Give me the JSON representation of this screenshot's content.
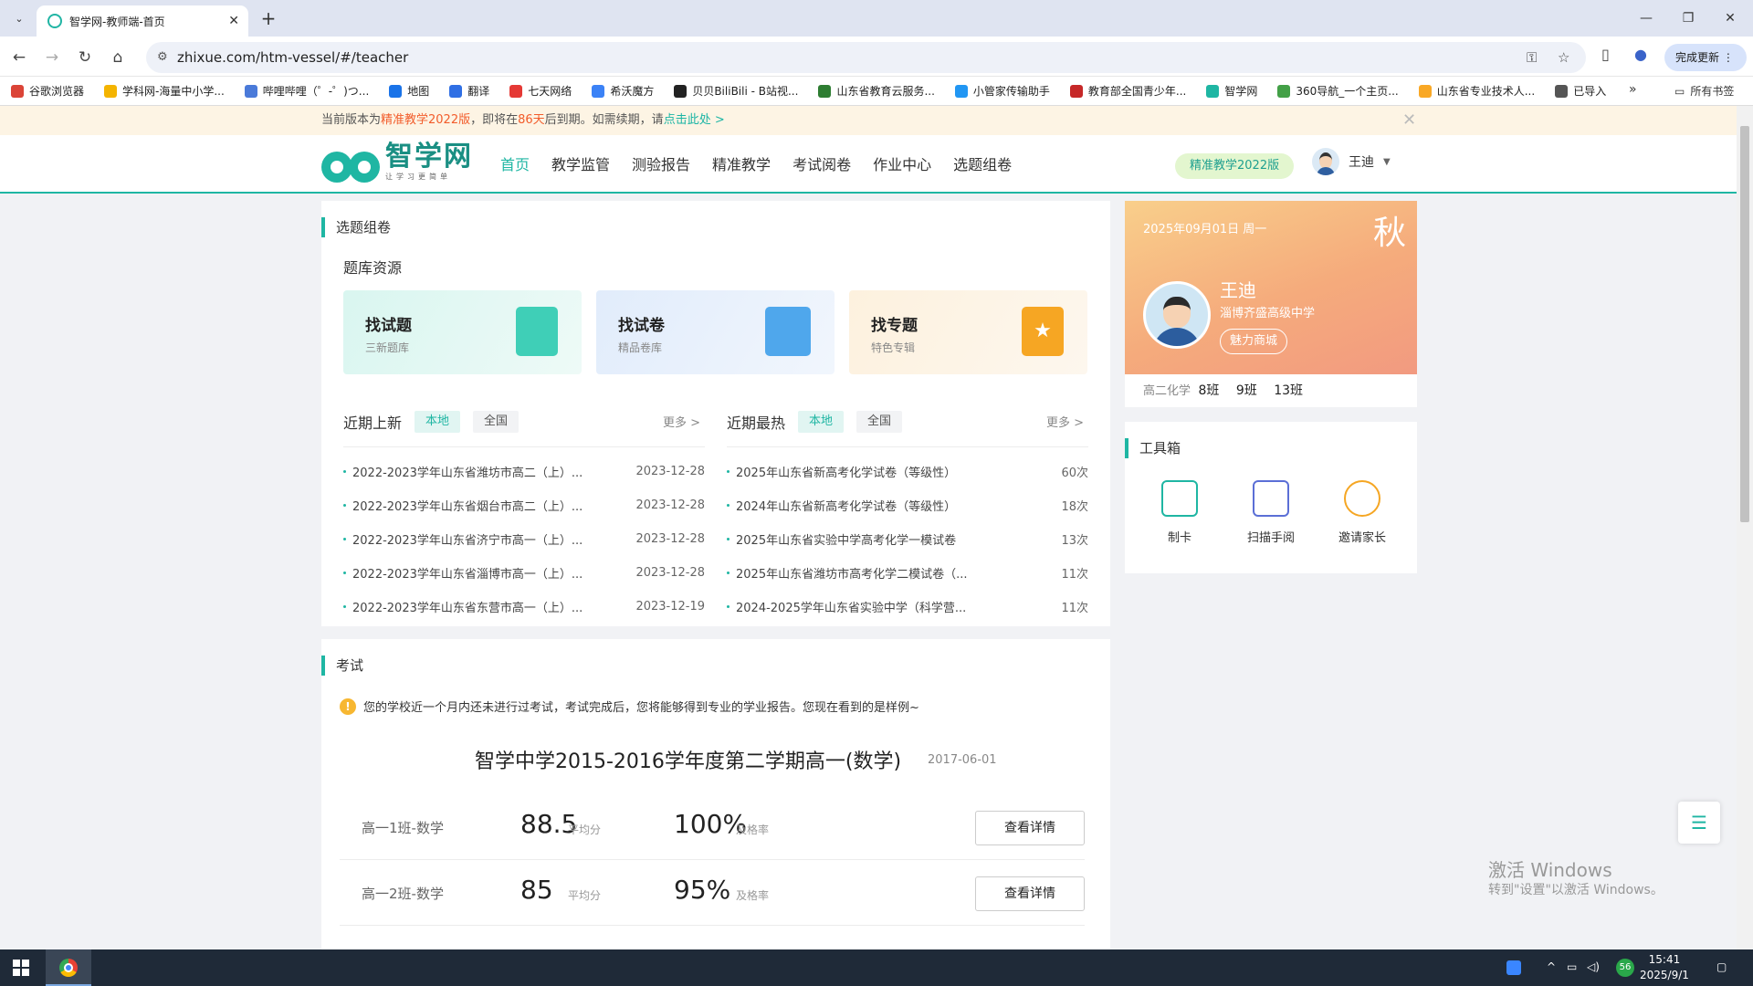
{
  "browser": {
    "tab_title": "智学网-教师端-首页",
    "url": "zhixue.com/htm-vessel/#/teacher",
    "update_label": "完成更新",
    "bookmarks": [
      {
        "label": "谷歌浏览器",
        "color": "#db4437"
      },
      {
        "label": "学科网-海量中小学...",
        "color": "#f4b400"
      },
      {
        "label": "哔哩哔哩（゜-゜)つ...",
        "color": "#4a7ad9"
      },
      {
        "label": "地图",
        "color": "#1a73e8"
      },
      {
        "label": "翻译",
        "color": "#2f6fe4"
      },
      {
        "label": "七天网络",
        "color": "#e53935"
      },
      {
        "label": "希沃魔方",
        "color": "#3b82f6"
      },
      {
        "label": "贝贝BiliBili - B站视...",
        "color": "#222222"
      },
      {
        "label": "山东省教育云服务...",
        "color": "#2e7d32"
      },
      {
        "label": "小管家传输助手",
        "color": "#2196f3"
      },
      {
        "label": "教育部全国青少年...",
        "color": "#c62828"
      },
      {
        "label": "智学网",
        "color": "#1fb6a3"
      },
      {
        "label": "360导航_一个主页...",
        "color": "#43a047"
      },
      {
        "label": "山东省专业技术人...",
        "color": "#f9a825"
      },
      {
        "label": "已导入",
        "color": "#555555"
      }
    ],
    "all_bookmarks_label": "所有书签"
  },
  "notice": {
    "prefix": "当前版本为",
    "version": "精准教学2022版",
    "mid": "，即将在",
    "days": "86天",
    "suffix": "后到期。如需续期，请",
    "link": "点击此处 >"
  },
  "header": {
    "logo_name": "智学网",
    "logo_slogan": "让学习更简单",
    "nav": [
      "首页",
      "教学监管",
      "测验报告",
      "精准教学",
      "考试阅卷",
      "作业中心",
      "选题组卷"
    ],
    "version_badge": "精准教学2022版",
    "user_name": "王迪"
  },
  "question_bank": {
    "section_title": "选题组卷",
    "sub_title": "题库资源",
    "resources": [
      {
        "title": "找试题",
        "sub": "三新题库"
      },
      {
        "title": "找试卷",
        "sub": "精品卷库"
      },
      {
        "title": "找专题",
        "sub": "特色专辑"
      }
    ],
    "recent": {
      "title": "近期上新",
      "tab_local": "本地",
      "tab_all": "全国",
      "more": "更多 >",
      "items": [
        {
          "text": "2022-2023学年山东省潍坊市高二（上）...",
          "date": "2023-12-28"
        },
        {
          "text": "2022-2023学年山东省烟台市高二（上）...",
          "date": "2023-12-28"
        },
        {
          "text": "2022-2023学年山东省济宁市高一（上）...",
          "date": "2023-12-28"
        },
        {
          "text": "2022-2023学年山东省淄博市高一（上）...",
          "date": "2023-12-28"
        },
        {
          "text": "2022-2023学年山东省东营市高一（上）...",
          "date": "2023-12-19"
        }
      ]
    },
    "hot": {
      "title": "近期最热",
      "tab_local": "本地",
      "tab_all": "全国",
      "more": "更多 >",
      "items": [
        {
          "text": "2025年山东省新高考化学试卷（等级性）",
          "count": "60次"
        },
        {
          "text": "2024年山东省新高考化学试卷（等级性）",
          "count": "18次"
        },
        {
          "text": "2025年山东省实验中学高考化学一模试卷",
          "count": "13次"
        },
        {
          "text": "2025年山东省潍坊市高考化学二模试卷（...",
          "count": "11次"
        },
        {
          "text": "2024-2025学年山东省实验中学（科学营...",
          "count": "11次"
        }
      ]
    }
  },
  "profile": {
    "date": "2025年09月01日 周一",
    "season": "秋",
    "name": "王迪",
    "school": "淄博齐盛高级中学",
    "mall": "魅力商城",
    "subject": "高二化学",
    "classes": [
      "8班",
      "9班",
      "13班"
    ]
  },
  "toolbox": {
    "title": "工具箱",
    "tools": [
      "制卡",
      "扫描手阅",
      "邀请家长"
    ]
  },
  "exam": {
    "section_title": "考试",
    "warning": "您的学校近一个月内还未进行过考试，考试完成后，您将能够得到专业的学业报告。您现在看到的是样例~",
    "title": "智学中学2015-2016学年度第二学期高一(数学)",
    "date": "2017-06-01",
    "rows": [
      {
        "cls": "高一1班-数学",
        "avg": "88.5",
        "avg_label": "平均分",
        "pass": "100%",
        "pass_label": "及格率",
        "btn": "查看详情"
      },
      {
        "cls": "高一2班-数学",
        "avg": "85",
        "avg_label": "平均分",
        "pass": "95%",
        "pass_label": "及格率",
        "btn": "查看详情"
      }
    ]
  },
  "watermark": {
    "line1": "激活 Windows",
    "line2": "转到\"设置\"以激活 Windows。"
  },
  "taskbar": {
    "time": "15:41",
    "date": "2025/9/1",
    "badge": "56"
  },
  "colors": {
    "accent": "#1fb6a3",
    "warning": "#f25c2b"
  }
}
